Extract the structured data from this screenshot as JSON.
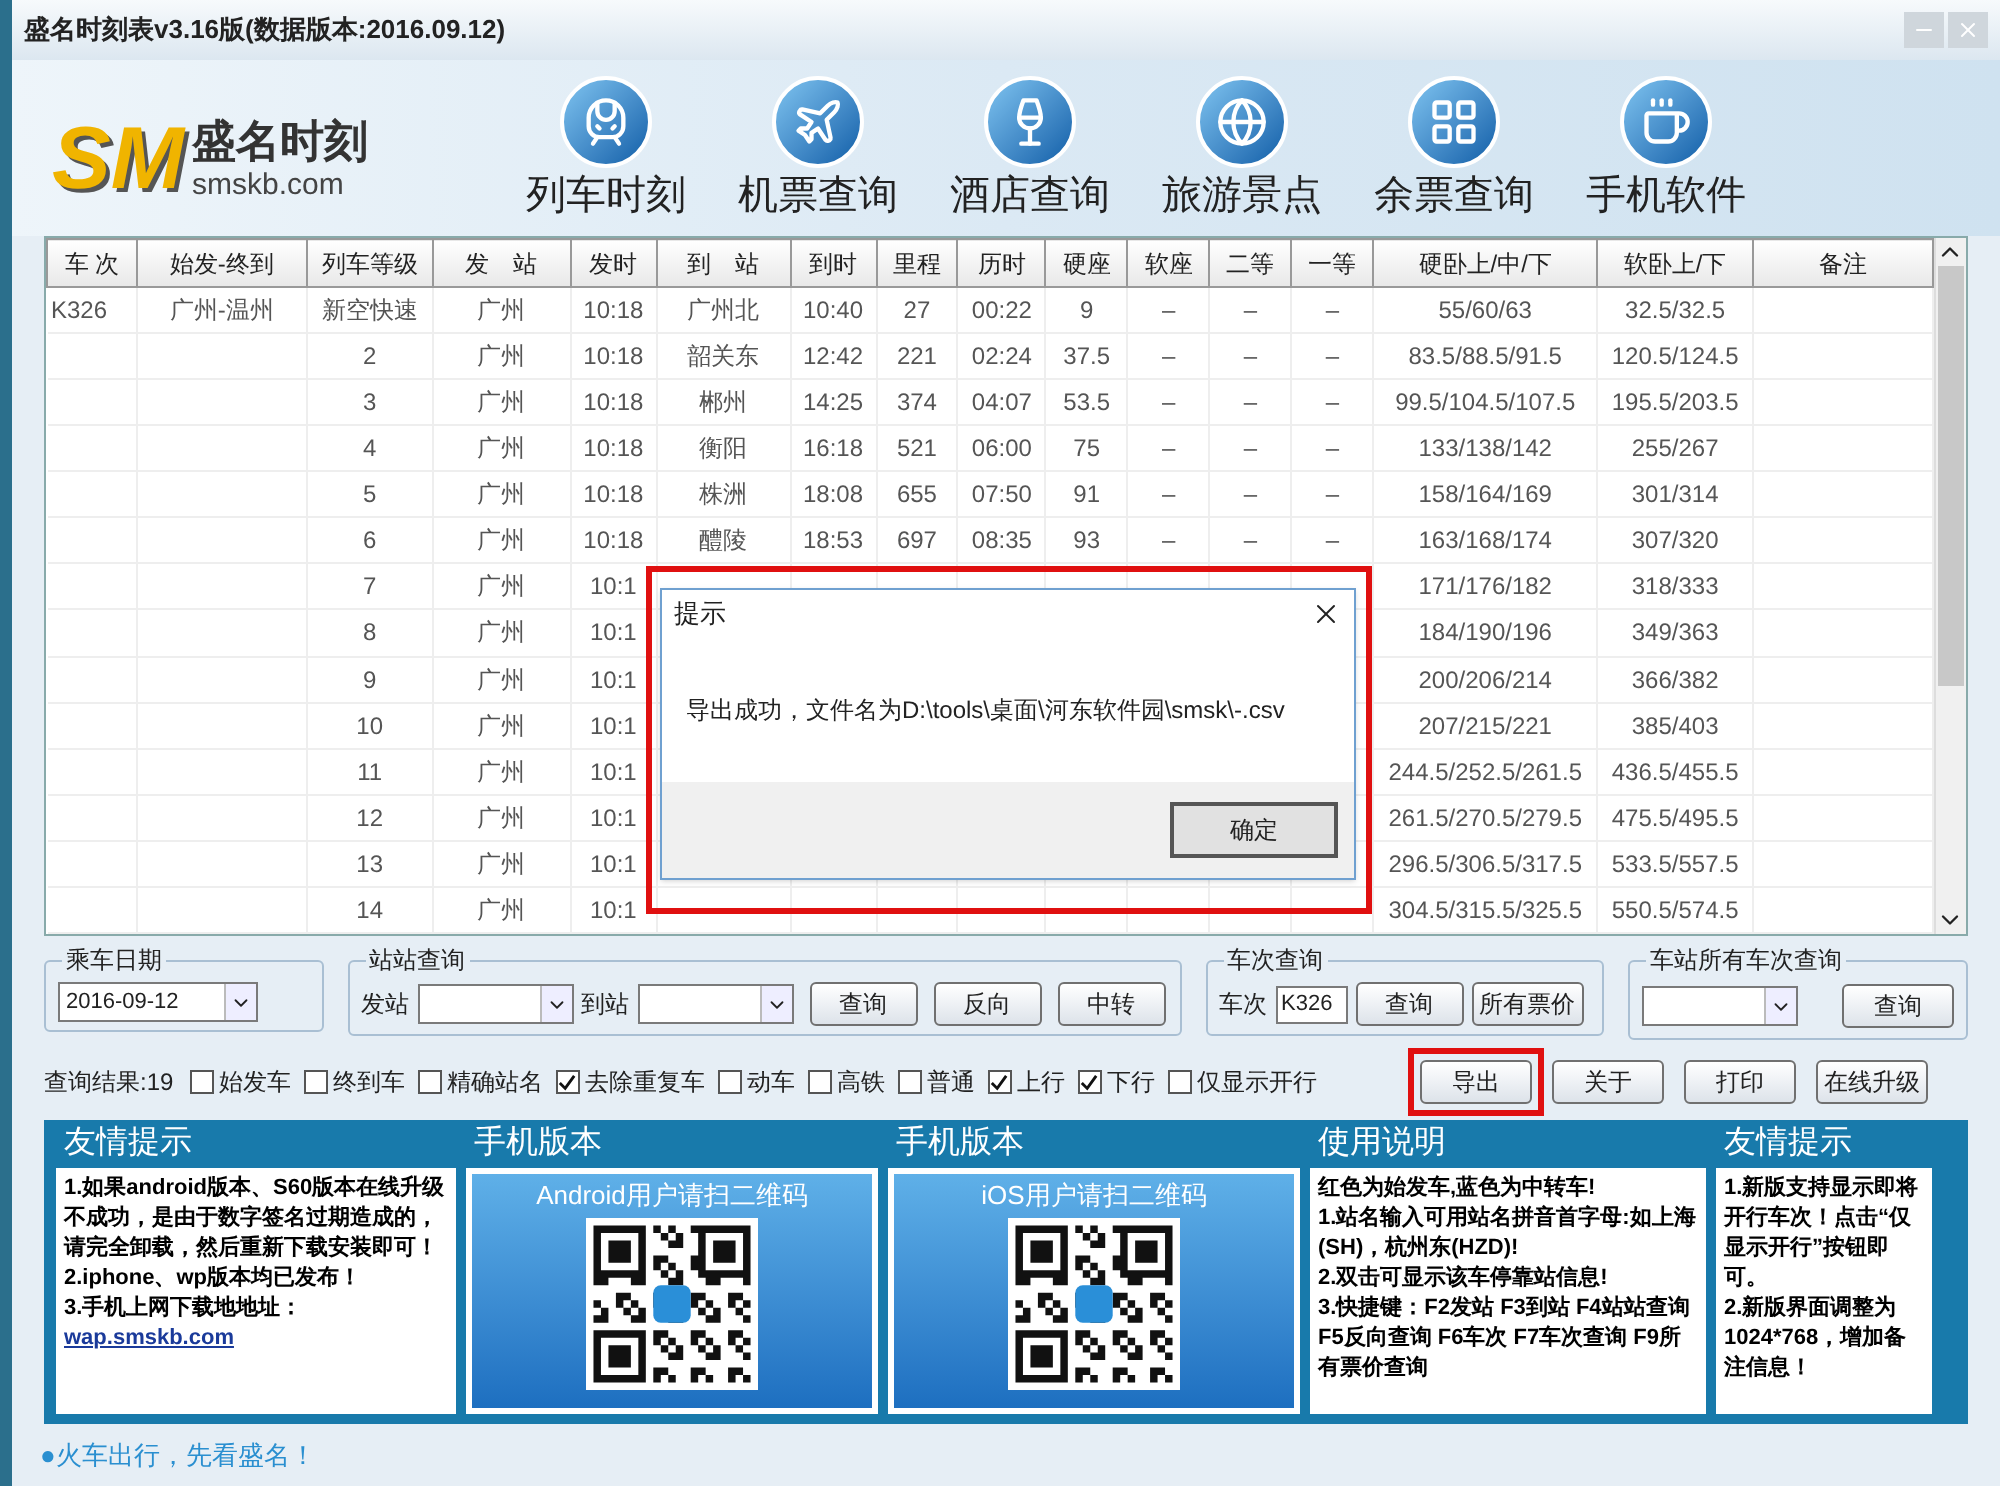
{
  "window": {
    "title": "盛名时刻表v3.16版(数据版本:2016.09.12)"
  },
  "logo": {
    "mark": "SM",
    "name": "盛名时刻",
    "site": "smskb.com"
  },
  "nav": [
    "列车时刻",
    "机票查询",
    "酒店查询",
    "旅游景点",
    "余票查询",
    "手机软件"
  ],
  "table": {
    "columns": [
      "车 次",
      "始发-终到",
      "列车等级",
      "发　站",
      "发时",
      "到　站",
      "到时",
      "里程",
      "历时",
      "硬座",
      "软座",
      "二等",
      "一等",
      "硬卧上/中/下",
      "软卧上/下",
      "备注"
    ],
    "rows": [
      {
        "train": "K326",
        "route": "广州-温州",
        "grade": "新空快速",
        "from": "广州",
        "dep": "10:18",
        "to": "广州北",
        "arr": "10:40",
        "km": "27",
        "dur": "00:22",
        "hard_seat": "9",
        "soft_seat": "–",
        "second": "–",
        "first": "–",
        "hard_sleeper": "55/60/63",
        "soft_sleeper": "32.5/32.5"
      },
      {
        "grade": "2",
        "from": "广州",
        "dep": "10:18",
        "to": "韶关东",
        "arr": "12:42",
        "km": "221",
        "dur": "02:24",
        "hard_seat": "37.5",
        "soft_seat": "–",
        "second": "–",
        "first": "–",
        "hard_sleeper": "83.5/88.5/91.5",
        "soft_sleeper": "120.5/124.5"
      },
      {
        "grade": "3",
        "from": "广州",
        "dep": "10:18",
        "to": "郴州",
        "arr": "14:25",
        "km": "374",
        "dur": "04:07",
        "hard_seat": "53.5",
        "soft_seat": "–",
        "second": "–",
        "first": "–",
        "hard_sleeper": "99.5/104.5/107.5",
        "soft_sleeper": "195.5/203.5"
      },
      {
        "grade": "4",
        "from": "广州",
        "dep": "10:18",
        "to": "衡阳",
        "arr": "16:18",
        "km": "521",
        "dur": "06:00",
        "hard_seat": "75",
        "soft_seat": "–",
        "second": "–",
        "first": "–",
        "hard_sleeper": "133/138/142",
        "soft_sleeper": "255/267"
      },
      {
        "grade": "5",
        "from": "广州",
        "dep": "10:18",
        "to": "株洲",
        "arr": "18:08",
        "km": "655",
        "dur": "07:50",
        "hard_seat": "91",
        "soft_seat": "–",
        "second": "–",
        "first": "–",
        "hard_sleeper": "158/164/169",
        "soft_sleeper": "301/314"
      },
      {
        "grade": "6",
        "from": "广州",
        "dep": "10:18",
        "to": "醴陵",
        "arr": "18:53",
        "km": "697",
        "dur": "08:35",
        "hard_seat": "93",
        "soft_seat": "–",
        "second": "–",
        "first": "–",
        "hard_sleeper": "163/168/174",
        "soft_sleeper": "307/320"
      },
      {
        "grade": "7",
        "from": "广州",
        "dep": "10:1",
        "hard_sleeper": "171/176/182",
        "soft_sleeper": "318/333"
      },
      {
        "grade": "8",
        "from": "广州",
        "dep": "10:1",
        "hard_sleeper": "184/190/196",
        "soft_sleeper": "349/363"
      },
      {
        "grade": "9",
        "from": "广州",
        "dep": "10:1",
        "hard_sleeper": "200/206/214",
        "soft_sleeper": "366/382"
      },
      {
        "grade": "10",
        "from": "广州",
        "dep": "10:1",
        "hard_sleeper": "207/215/221",
        "soft_sleeper": "385/403"
      },
      {
        "grade": "11",
        "from": "广州",
        "dep": "10:1",
        "hard_sleeper": "244.5/252.5/261.5",
        "soft_sleeper": "436.5/455.5"
      },
      {
        "grade": "12",
        "from": "广州",
        "dep": "10:1",
        "hard_sleeper": "261.5/270.5/279.5",
        "soft_sleeper": "475.5/495.5"
      },
      {
        "grade": "13",
        "from": "广州",
        "dep": "10:1",
        "hard_sleeper": "296.5/306.5/317.5",
        "soft_sleeper": "533.5/557.5"
      },
      {
        "grade": "14",
        "from": "广州",
        "dep": "10:1",
        "hard_sleeper": "304.5/315.5/325.5",
        "soft_sleeper": "550.5/574.5"
      }
    ]
  },
  "dialog": {
    "title": "提示",
    "message": "导出成功，文件名为D:\\tools\\桌面\\河东软件园\\smsk\\-.csv",
    "button": "确定"
  },
  "date_group": {
    "title": "乘车日期",
    "value": "2016-09-12"
  },
  "station_group": {
    "title": "站站查询",
    "from_label": "发站",
    "to_label": "到站",
    "buttons": [
      "查询",
      "反向",
      "中转"
    ]
  },
  "train_group": {
    "title": "车次查询",
    "label": "车次",
    "value": "K326",
    "buttons": [
      "查询",
      "所有票价"
    ]
  },
  "all_group": {
    "title": "车站所有车次查询",
    "buttons": [
      "查询"
    ]
  },
  "result": "查询结果:19",
  "filters": [
    {
      "label": "始发车",
      "checked": false
    },
    {
      "label": "终到车",
      "checked": false
    },
    {
      "label": "精确站名",
      "checked": false
    },
    {
      "label": "去除重复车",
      "checked": true
    },
    {
      "label": "动车",
      "checked": false
    },
    {
      "label": "高铁",
      "checked": false
    },
    {
      "label": "普通",
      "checked": false
    },
    {
      "label": "上行",
      "checked": true
    },
    {
      "label": "下行",
      "checked": true
    },
    {
      "label": "仅显示开行",
      "checked": false
    }
  ],
  "actions": [
    {
      "label": "导出",
      "highlighted": true
    },
    {
      "label": "关于",
      "highlighted": false
    },
    {
      "label": "打印",
      "highlighted": false
    },
    {
      "label": "在线升级",
      "highlighted": false
    }
  ],
  "panels": [
    {
      "kind": "text",
      "title": "友情提示",
      "lines": [
        "1.如果android版本、S60版本在线升级不成功，是由于数字签名过期造成的，请完全卸载，然后重新下载安装即可！",
        "2.iphone、wp版本均已发布！",
        "3.手机上网下载地地址："
      ],
      "link": "wap.smskb.com"
    },
    {
      "kind": "qr",
      "title": "手机版本",
      "banner": "Android用户请扫二维码"
    },
    {
      "kind": "qr",
      "title": "手机版本",
      "banner": "iOS用户请扫二维码"
    },
    {
      "kind": "text",
      "title": "使用说明",
      "lines": [
        "红色为始发车,蓝色为中转车!",
        "1.站名输入可用站名拼音首字母:如上海(SH)，杭州东(HZD)!",
        "2.双击可显示该车停靠站信息!",
        "3.快捷键：F2发站 F3到站 F4站站查询 F5反向查询 F6车次 F7车次查询 F9所有票价查询"
      ]
    },
    {
      "kind": "text",
      "title": "友情提示",
      "lines": [
        "1.新版支持显示即将开行车次！点击“仅显示开行”按钮即可。",
        "2.新版界面调整为1024*768，增加备注信息！"
      ]
    }
  ],
  "status": "●火车出行，先看盛名！"
}
